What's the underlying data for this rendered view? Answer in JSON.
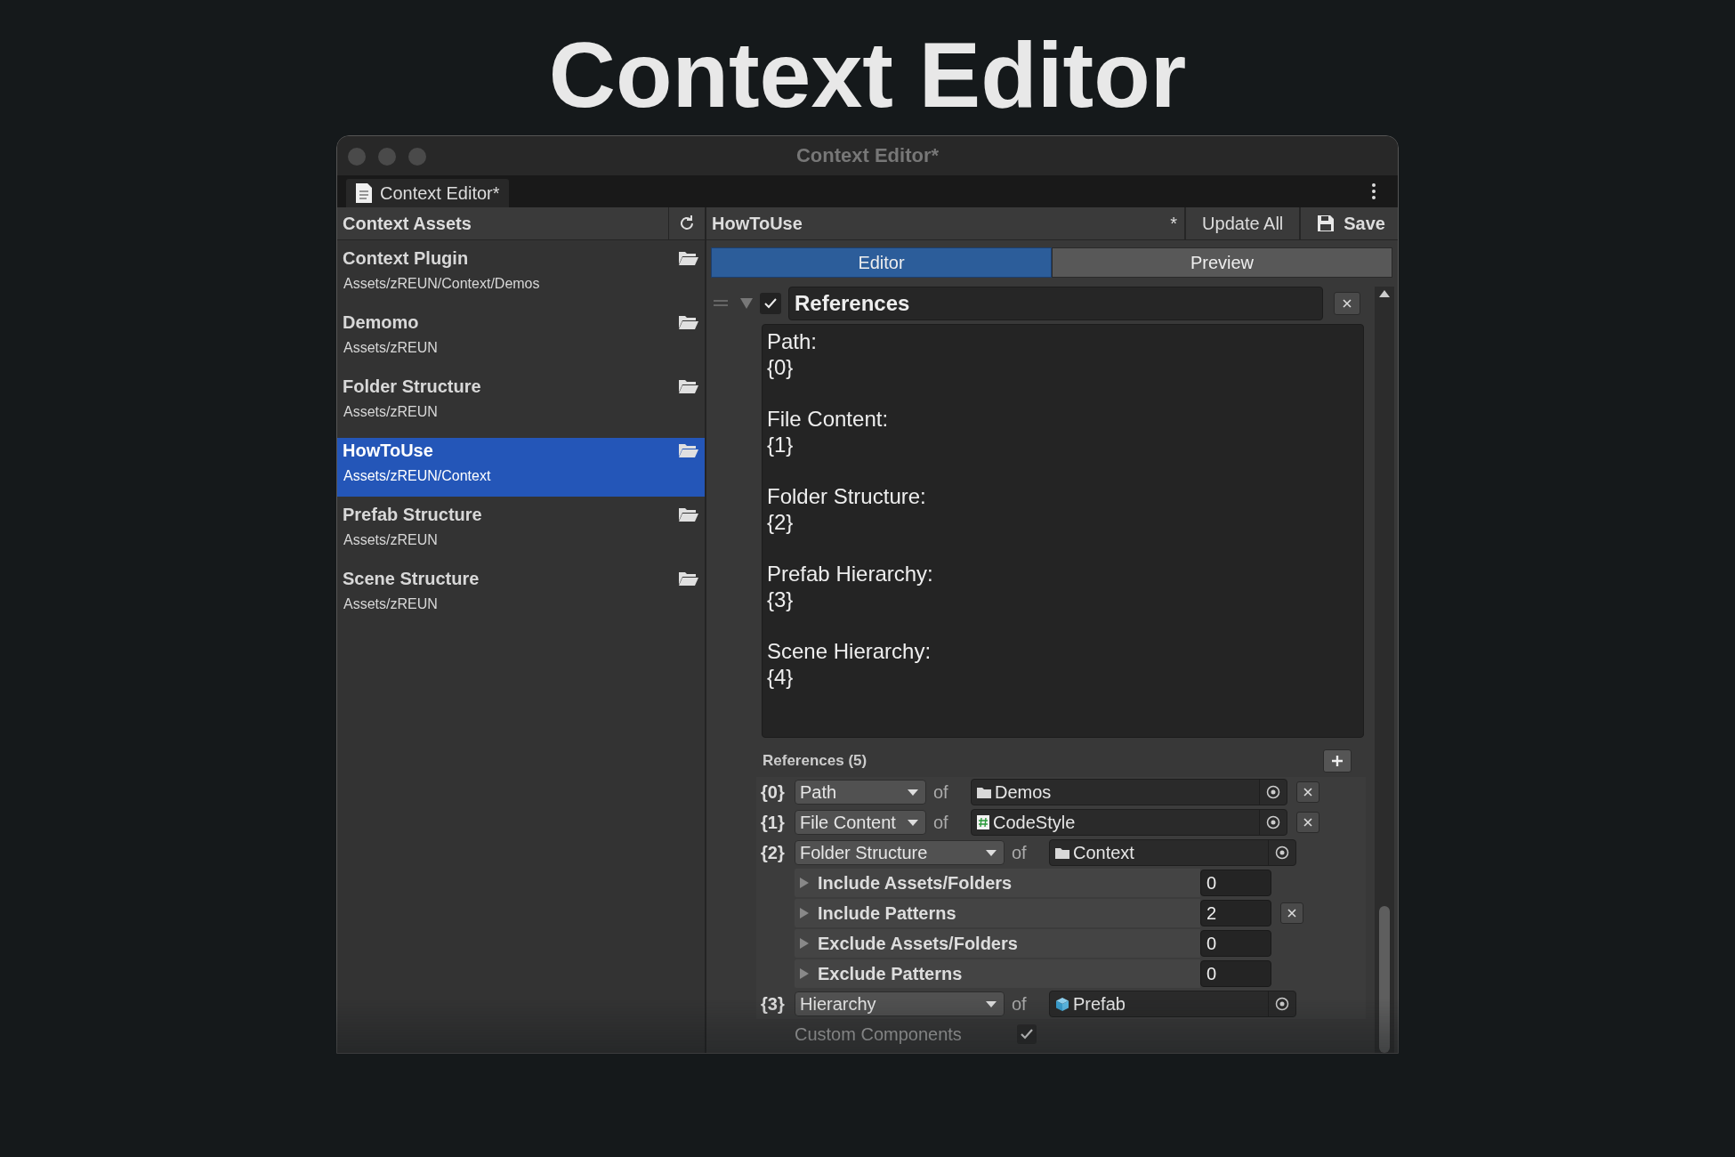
{
  "page_title": "Context Editor",
  "window": {
    "title": "Context Editor*"
  },
  "tab": {
    "label": "Context Editor*"
  },
  "sidebar": {
    "title": "Context Assets",
    "items": [
      {
        "name": "Context Plugin",
        "path": "Assets/zREUN/Context/Demos",
        "selected": false
      },
      {
        "name": "Demomo",
        "path": "Assets/zREUN",
        "selected": false
      },
      {
        "name": "Folder Structure",
        "path": "Assets/zREUN",
        "selected": false
      },
      {
        "name": "HowToUse",
        "path": "Assets/zREUN/Context",
        "selected": true
      },
      {
        "name": "Prefab Structure",
        "path": "Assets/zREUN",
        "selected": false
      },
      {
        "name": "Scene Structure",
        "path": "Assets/zREUN",
        "selected": false
      }
    ]
  },
  "editor": {
    "asset_name": "HowToUse",
    "dirty_mark": "*",
    "update_button": "Update All",
    "save_button": "Save"
  },
  "view_tabs": [
    {
      "label": "Editor",
      "selected": true
    },
    {
      "label": "Preview",
      "selected": false
    }
  ],
  "section": {
    "title": "References",
    "enabled": true,
    "expanded": true,
    "template": "Path:\n{0}\n\nFile Content:\n{1}\n\nFolder Structure:\n{2}\n\nPrefab Hierarchy:\n{3}\n\nScene Hierarchy:\n{4}"
  },
  "references": {
    "header": "References (5)",
    "items": [
      {
        "index": "{0}",
        "type": "Path",
        "of_label": "of",
        "target": "Demos",
        "kind": "folder",
        "removable": true
      },
      {
        "index": "{1}",
        "type": "File Content",
        "of_label": "of",
        "target": "CodeStyle",
        "kind": "script",
        "removable": true
      },
      {
        "index": "{2}",
        "type": "Folder Structure",
        "of_label": "of",
        "target": "Context",
        "kind": "folder",
        "removable": false,
        "options": [
          {
            "kind": "count",
            "label": "Include Assets/Folders",
            "value": "0",
            "expanded": false,
            "removable": false
          },
          {
            "kind": "count",
            "label": "Include Patterns",
            "value": "2",
            "expanded": false,
            "removable": true
          },
          {
            "kind": "count",
            "label": "Exclude Assets/Folders",
            "value": "0",
            "expanded": false,
            "removable": false
          },
          {
            "kind": "count",
            "label": "Exclude Patterns",
            "value": "0",
            "expanded": false,
            "removable": false
          }
        ]
      },
      {
        "index": "{3}",
        "type": "Hierarchy",
        "of_label": "of",
        "target": "Prefab",
        "kind": "prefab",
        "removable": false,
        "options": [
          {
            "kind": "toggle",
            "label": "Custom Components",
            "checked": true
          }
        ]
      }
    ]
  }
}
